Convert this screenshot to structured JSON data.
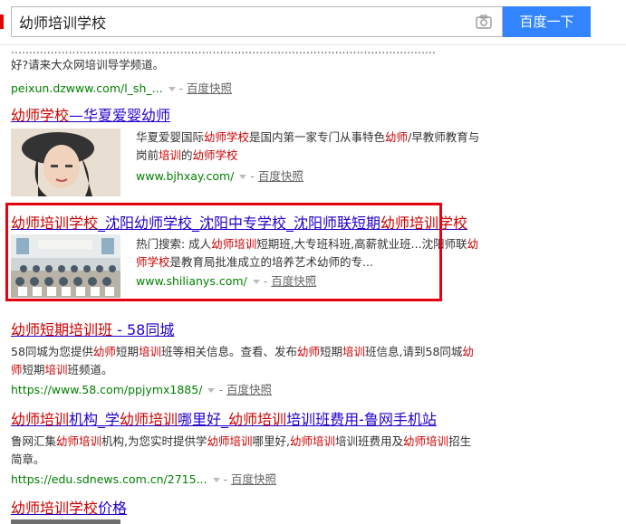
{
  "search": {
    "query": "幼师培训学校",
    "button_label": "百度一下"
  },
  "results": [
    {
      "desc_lines": [
        "......................................................................................................................",
        "好?请来大众网培训导学频道。"
      ],
      "url": "peixun.dzwww.com/l_sh_...",
      "snapshot": "百度快照"
    },
    {
      "title_parts": [
        {
          "t": "幼师学校",
          "em": true
        },
        {
          "t": "—华夏爱婴幼师",
          "em": false
        }
      ],
      "desc_parts_1": [
        {
          "t": "华夏爱婴国际",
          "em": false
        },
        {
          "t": "幼师学校",
          "em": true
        },
        {
          "t": "是国内第一家专门从事特色",
          "em": false
        },
        {
          "t": "幼师",
          "em": true
        },
        {
          "t": "/早教师教育与",
          "em": false
        }
      ],
      "desc_parts_2": [
        {
          "t": "岗前",
          "em": false
        },
        {
          "t": "培训",
          "em": true
        },
        {
          "t": "的",
          "em": false
        },
        {
          "t": "幼师学校",
          "em": true
        }
      ],
      "url": "www.bjhxay.com/",
      "snapshot": "百度快照"
    },
    {
      "title_parts": [
        {
          "t": "幼师培训学校",
          "em": true
        },
        {
          "t": "_沈阳幼师学校_沈阳中专学校_沈阳师联短期",
          "em": false
        },
        {
          "t": "幼师培训学校",
          "em": true
        }
      ],
      "desc_parts_1": [
        {
          "t": "热门搜索: 成人",
          "em": false
        },
        {
          "t": "幼师培训",
          "em": true
        },
        {
          "t": "短期班,大专班科班,高薪就业班...沈阳师联",
          "em": false
        },
        {
          "t": "幼",
          "em": true
        }
      ],
      "desc_parts_2": [
        {
          "t": "师学校",
          "em": true
        },
        {
          "t": "是教育局批准成立的培养艺术幼师的专...",
          "em": false
        }
      ],
      "url": "www.shilianys.com/",
      "snapshot": "百度快照"
    },
    {
      "title_parts": [
        {
          "t": "幼师短期培训班",
          "em": true
        },
        {
          "t": " - 58同城",
          "em": false
        }
      ],
      "desc_parts_1": [
        {
          "t": "58同城为您提供",
          "em": false
        },
        {
          "t": "幼师",
          "em": true
        },
        {
          "t": "短期",
          "em": false
        },
        {
          "t": "培训",
          "em": true
        },
        {
          "t": "班等相关信息。查看、发布",
          "em": false
        },
        {
          "t": "幼师",
          "em": true
        },
        {
          "t": "短期",
          "em": false
        },
        {
          "t": "培训",
          "em": true
        },
        {
          "t": "班信息,请到58同城",
          "em": false
        },
        {
          "t": "幼",
          "em": true
        }
      ],
      "desc_parts_2": [
        {
          "t": "师",
          "em": true
        },
        {
          "t": "短期",
          "em": false
        },
        {
          "t": "培训",
          "em": true
        },
        {
          "t": "班频道。",
          "em": false
        }
      ],
      "url": "https://www.58.com/ppjymx1885/",
      "snapshot": "百度快照"
    },
    {
      "title_parts": [
        {
          "t": "幼师培训",
          "em": true
        },
        {
          "t": "机构_学",
          "em": false
        },
        {
          "t": "幼师培训",
          "em": true
        },
        {
          "t": "哪里好_",
          "em": false
        },
        {
          "t": "幼师培训",
          "em": true
        },
        {
          "t": "培训班费用-鲁网手机站",
          "em": false
        }
      ],
      "desc_parts_1": [
        {
          "t": "鲁网汇集",
          "em": false
        },
        {
          "t": "幼师培训",
          "em": true
        },
        {
          "t": "机构,为您实时提供学",
          "em": false
        },
        {
          "t": "幼师培训",
          "em": true
        },
        {
          "t": "哪里好,",
          "em": false
        },
        {
          "t": "幼师培训",
          "em": true
        },
        {
          "t": "培训班费用及",
          "em": false
        },
        {
          "t": "幼师培训",
          "em": true
        },
        {
          "t": "招生",
          "em": false
        }
      ],
      "desc_parts_2": [
        {
          "t": "简章。",
          "em": false
        }
      ],
      "url": "https://edu.sdnews.com.cn/2715...",
      "snapshot": "百度快照"
    },
    {
      "title_parts": [
        {
          "t": "幼师培训学校",
          "em": true
        },
        {
          "t": "价格",
          "em": false
        }
      ]
    }
  ],
  "colors": {
    "accent": "#3385ff",
    "title_link": "#2200cc",
    "highlight": "#cc0000",
    "url_green": "#008000",
    "annotation_box": "#e60012"
  }
}
